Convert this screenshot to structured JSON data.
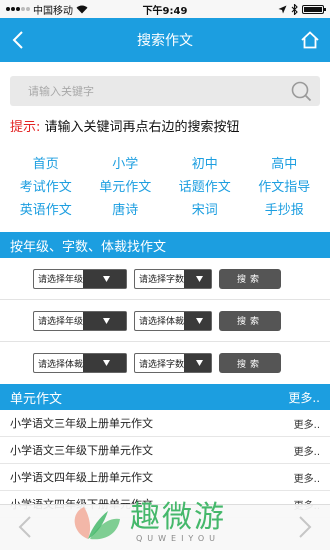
{
  "status_bar": {
    "carrier": "中国移动",
    "time": "下午9:49"
  },
  "nav": {
    "title": "搜索作文",
    "back_icon": "chevron-left-icon",
    "home_icon": "home-icon"
  },
  "search": {
    "placeholder": "请输入关键字",
    "value": ""
  },
  "tip": {
    "label": "提示:",
    "text": "请输入关键词再点右边的搜索按钮"
  },
  "categories": [
    "首页",
    "小学",
    "初中",
    "高中",
    "考试作文",
    "单元作文",
    "话题作文",
    "作文指导",
    "英语作文",
    "唐诗",
    "宋词",
    "手抄报"
  ],
  "filter_section": {
    "title": "按年级、字数、体裁找作文",
    "rows": [
      {
        "select1": "请选择年级",
        "select2": "请选择字数",
        "button": "搜索"
      },
      {
        "select1": "请选择年级",
        "select2": "请选择体裁",
        "button": "搜索"
      },
      {
        "select1": "请选择体裁",
        "select2": "请选择字数",
        "button": "搜索"
      }
    ]
  },
  "unit_section": {
    "title": "单元作文",
    "more": "更多..",
    "items": [
      {
        "title": "小学语文三年级上册单元作文",
        "more": "更多.."
      },
      {
        "title": "小学语文三年级下册单元作文",
        "more": "更多.."
      },
      {
        "title": "小学语文四年级上册单元作文",
        "more": "更多.."
      },
      {
        "title": "小学语文四年级下册单元作文",
        "more": "更多.."
      }
    ]
  },
  "watermark": {
    "brand_cn": "趣微游",
    "brand_en": "QUWEIYOU"
  },
  "colors": {
    "accent": "#1c9ee0",
    "tip_label": "#e32424",
    "button": "#555555",
    "brand": "#45b86b"
  }
}
